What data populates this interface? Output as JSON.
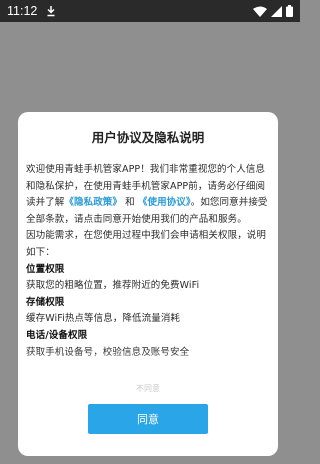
{
  "status_bar": {
    "time": "11:12",
    "download_icon": "download-icon",
    "wifi_icon": "wifi-icon",
    "signal_icon": "signal-icon",
    "battery_icon": "battery-icon"
  },
  "dialog": {
    "title": "用户协议及隐私说明",
    "intro_1": "欢迎使用青蛙手机管家APP！我们非常重视您的个人信息和隐私保护，在使用青蛙手机管家APP前，请务必仔细阅读并了解",
    "privacy_link": "《隐私政策》",
    "and": "和",
    "terms_link": "《使用协议》",
    "intro_2": "。如您同意并接受全部条款，请点击同意开始使用我们的产品和服务。",
    "perm_intro": "因功能需求，在您使用过程中我们会申请相关权限，说明如下：",
    "sections": [
      {
        "heading": "位置权限",
        "text": "获取您的粗略位置，推荐附近的免费WiFi"
      },
      {
        "heading": "存储权限",
        "text": "缓存WiFi热点等信息，降低流量消耗"
      },
      {
        "heading": "电话/设备权限",
        "text": "获取手机设备号，校验信息及账号安全"
      }
    ],
    "disagree_label": "不同意",
    "agree_label": "同意"
  },
  "colors": {
    "accent": "#2aa6e8",
    "link": "#2a9bd6",
    "overlay": "#8f8f8f",
    "status_bar": "#2a2a2a"
  }
}
